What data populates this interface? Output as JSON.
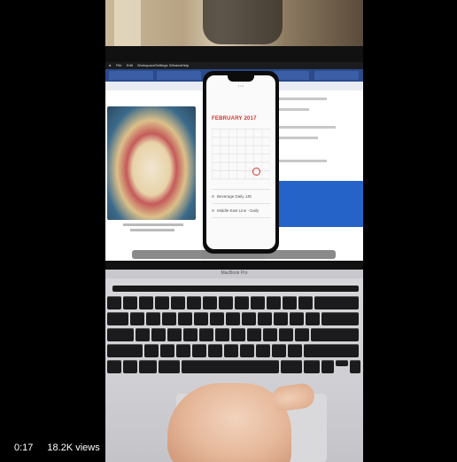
{
  "video": {
    "timestamp": "0:17",
    "views": "18.2K views"
  },
  "laptop": {
    "menubar": {
      "items": [
        "File",
        "Edit",
        "Workspace",
        "Settings",
        "Window",
        "Help"
      ]
    },
    "brand_label": "MacBook Pro"
  },
  "phone": {
    "calendar_month": "FEBRUARY 2017",
    "today": "22",
    "events": [
      "Beverage Daily JJE",
      "Middle East Line - Daily"
    ]
  }
}
